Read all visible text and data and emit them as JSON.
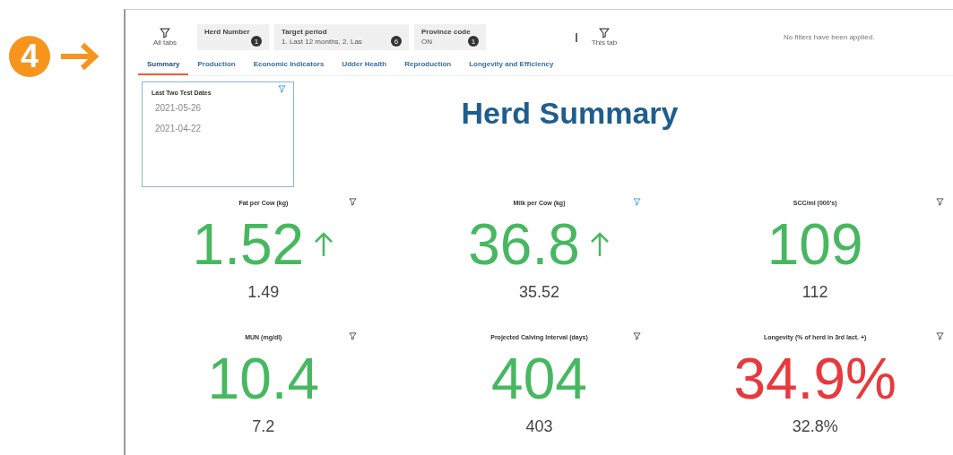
{
  "annotation": {
    "step": "4"
  },
  "filters": {
    "all_tabs_label": "All tabs",
    "chips": [
      {
        "title": "Herd Number",
        "count": "1"
      },
      {
        "title": "Target period",
        "value": "1. Last 12 months, 2. Las",
        "count": "6"
      },
      {
        "title": "Province code",
        "value": "ON",
        "count": "1"
      }
    ],
    "this_tab_label": "This tab",
    "message": "No filters have been applied."
  },
  "tabs": [
    {
      "label": "Summary",
      "selected": true
    },
    {
      "label": "Production",
      "selected": false
    },
    {
      "label": "Economic Indicators",
      "selected": false
    },
    {
      "label": "Udder Health",
      "selected": false
    },
    {
      "label": "Reproduction",
      "selected": false
    },
    {
      "label": "Longevity and Efficiency",
      "selected": false
    }
  ],
  "test_dates": {
    "title": "Last Two Test Dates",
    "filter_active": true,
    "dates": [
      "2021-05-26",
      "2021-04-22"
    ]
  },
  "page_title": "Herd Summary",
  "tiles": [
    {
      "title": "Fat per Cow (kg)",
      "value": "1.52",
      "trend_up": true,
      "color": "#47b860",
      "previous": "1.49",
      "filter_active": false
    },
    {
      "title": "Milk per Cow (kg)",
      "value": "36.8",
      "trend_up": true,
      "color": "#47b860",
      "previous": "35.52",
      "filter_active": true
    },
    {
      "title": "SCC/ml (000's)",
      "value": "109",
      "trend_up": false,
      "color": "#47b860",
      "previous": "112",
      "filter_active": false
    },
    {
      "title": "MUN (mg/dl)",
      "value": "10.4",
      "trend_up": false,
      "color": "#47b860",
      "previous": "7.2",
      "filter_active": false
    },
    {
      "title": "Projected Calving Interval (days)",
      "value": "404",
      "trend_up": false,
      "color": "#47b860",
      "previous": "403",
      "filter_active": false
    },
    {
      "title": "Longevity (% of herd in 3rd lact. +)",
      "value": "34.9%",
      "trend_up": false,
      "color": "#e8393c",
      "previous": "32.8%",
      "filter_active": false
    }
  ]
}
